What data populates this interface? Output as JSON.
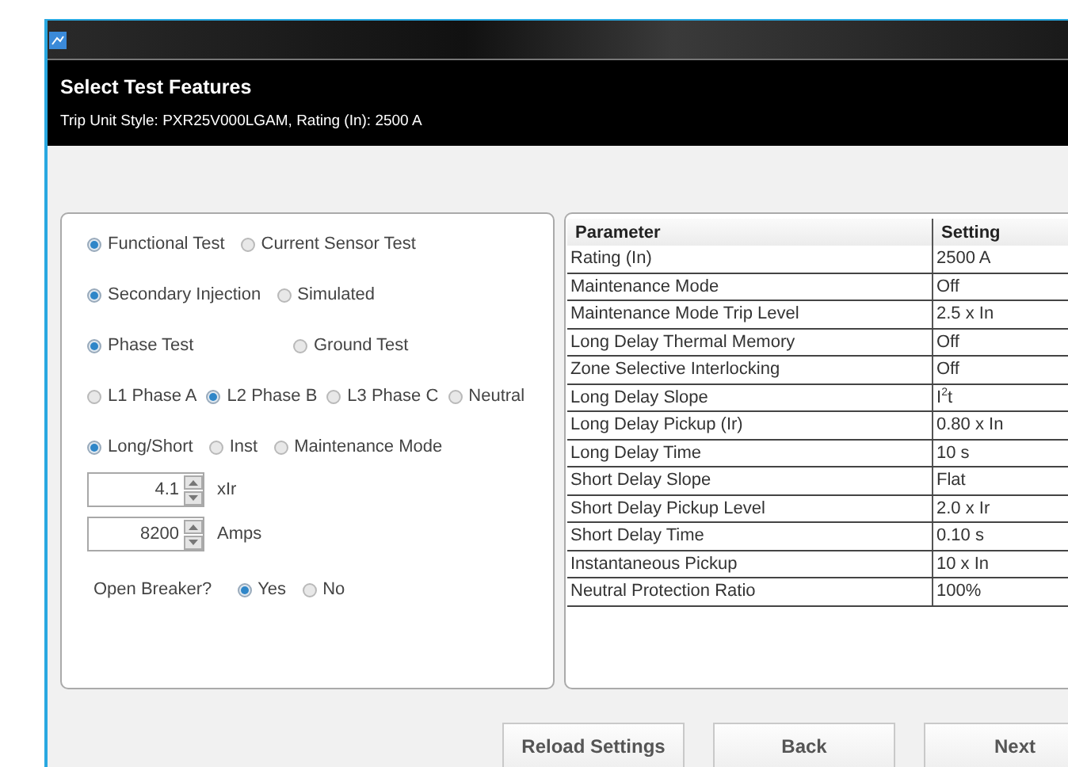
{
  "header": {
    "title": "Select Test Features",
    "subtitle": "Trip Unit Style: PXR25V000LGAM, Rating (In): 2500 A"
  },
  "radio_groups": [
    {
      "options": [
        {
          "label": "Functional Test",
          "selected": true
        },
        {
          "label": "Current Sensor Test",
          "selected": false
        }
      ]
    },
    {
      "options": [
        {
          "label": "Secondary Injection",
          "selected": true
        },
        {
          "label": "Simulated",
          "selected": false
        }
      ]
    },
    {
      "options": [
        {
          "label": "Phase Test",
          "selected": true
        },
        {
          "label": "Ground Test",
          "selected": false
        }
      ]
    },
    {
      "options": [
        {
          "label": "L1 Phase A",
          "selected": false
        },
        {
          "label": "L2 Phase B",
          "selected": true
        },
        {
          "label": "L3 Phase C",
          "selected": false
        },
        {
          "label": "Neutral",
          "selected": false
        }
      ]
    },
    {
      "options": [
        {
          "label": "Long/Short",
          "selected": true
        },
        {
          "label": "Inst",
          "selected": false
        },
        {
          "label": "Maintenance Mode",
          "selected": false
        }
      ]
    }
  ],
  "spinners": [
    {
      "value": "4.1",
      "unit": "xIr"
    },
    {
      "value": "8200",
      "unit": "Amps"
    }
  ],
  "open_breaker": {
    "label": "Open Breaker?",
    "options": [
      {
        "label": "Yes",
        "selected": true
      },
      {
        "label": "No",
        "selected": false
      }
    ]
  },
  "table": {
    "columns": [
      "Parameter",
      "Setting"
    ],
    "rows": [
      [
        "Rating (In)",
        "2500 A"
      ],
      [
        "Maintenance Mode",
        "Off"
      ],
      [
        "Maintenance Mode Trip Level",
        "2.5 x In"
      ],
      [
        "Long Delay Thermal Memory",
        "Off"
      ],
      [
        "Zone Selective Interlocking",
        "Off"
      ],
      [
        "Long Delay Slope",
        "I$^{2}$t"
      ],
      [
        "Long Delay Pickup (Ir)",
        "0.80 x In"
      ],
      [
        "Long Delay Time",
        "10 s"
      ],
      [
        "Short Delay Slope",
        "Flat"
      ],
      [
        "Short Delay Pickup Level",
        "2.0 x Ir"
      ],
      [
        "Short Delay Time",
        "0.10 s"
      ],
      [
        "Instantaneous Pickup",
        "10 x In"
      ],
      [
        "Neutral Protection Ratio",
        "100%"
      ]
    ]
  },
  "buttons": [
    "Reload Settings",
    "Back",
    "Next"
  ]
}
